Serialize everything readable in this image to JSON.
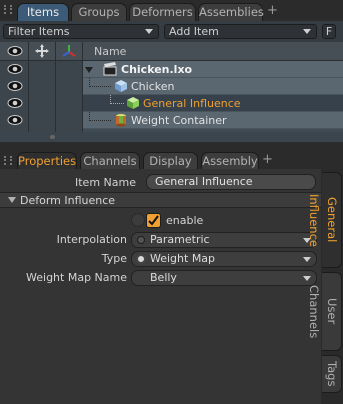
{
  "top_tabs": [
    "Items",
    "Groups",
    "Deformers",
    "Assemblies"
  ],
  "top_tab_plus": "+",
  "items_toolbar": {
    "filter_label": "Filter Items",
    "add_label": "Add Item",
    "f_label": "F"
  },
  "list": {
    "header_name": "Name",
    "rows": [
      {
        "label": "Chicken.lxo",
        "style": "bold",
        "icon": "scene-clapper-icon"
      },
      {
        "label": "Chicken",
        "style": "normal",
        "icon": "mesh-cube-icon"
      },
      {
        "label": "General Influence",
        "style": "highlight",
        "icon": "influence-cube-icon"
      },
      {
        "label": "Weight Container",
        "style": "normal",
        "icon": "weight-container-icon"
      }
    ]
  },
  "bottom_tabs": [
    "Properties",
    "Channels",
    "Display",
    "Assembly"
  ],
  "bottom_tab_plus": "+",
  "side_tabs": [
    "General Influence",
    "User Channels",
    "Tags"
  ],
  "properties": {
    "item_name_label": "Item Name",
    "item_name_value": "General Influence",
    "section_title": "Deform Influence",
    "enable_label": "enable",
    "interpolation_label": "Interpolation",
    "interpolation_value": "Parametric",
    "type_label": "Type",
    "type_value": "Weight Map",
    "weight_map_label": "Weight Map Name",
    "weight_map_value": "Belly"
  },
  "colors": {
    "accent_orange": "#f0a030",
    "selected_tab_blue": "#3b5b78"
  }
}
